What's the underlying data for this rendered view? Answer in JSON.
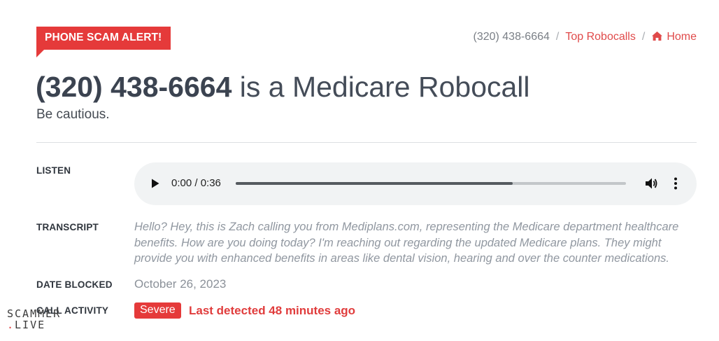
{
  "alert_badge": "PHONE SCAM ALERT!",
  "breadcrumb": {
    "current": "(320) 438-6664",
    "separator": "/",
    "top_robocalls": "Top Robocalls",
    "home": "Home"
  },
  "headline": {
    "phone": "(320) 438-6664",
    "text": " is a Medicare Robocall"
  },
  "subtitle": "Be cautious.",
  "listen": {
    "label": "LISTEN",
    "time": "0:00 / 0:36",
    "progress": 0.71
  },
  "transcript": {
    "label": "TRANSCRIPT",
    "text": "Hello? Hey, this is Zach calling you from Mediplans.com, representing the Medicare department healthcare benefits. How are you doing today? I'm reaching out regarding the updated Medicare plans. They might provide you with enhanced benefits in areas like dental vision, hearing and over the counter medications."
  },
  "date_blocked": {
    "label": "DATE BLOCKED",
    "value": "October 26, 2023"
  },
  "call_activity": {
    "label": "CALL ACTIVITY",
    "severity": "Severe",
    "detected": "Last detected 48 minutes ago"
  },
  "watermark": {
    "line1": "SCAMMER",
    "dot": ".",
    "line2": "LIVE"
  },
  "colors": {
    "accent_red": "#e53a3a",
    "audio_bg": "#f1f3f4",
    "muted_text": "#9097a0"
  },
  "icons": [
    "home-icon",
    "play-icon",
    "volume-icon",
    "more-vertical-icon"
  ]
}
